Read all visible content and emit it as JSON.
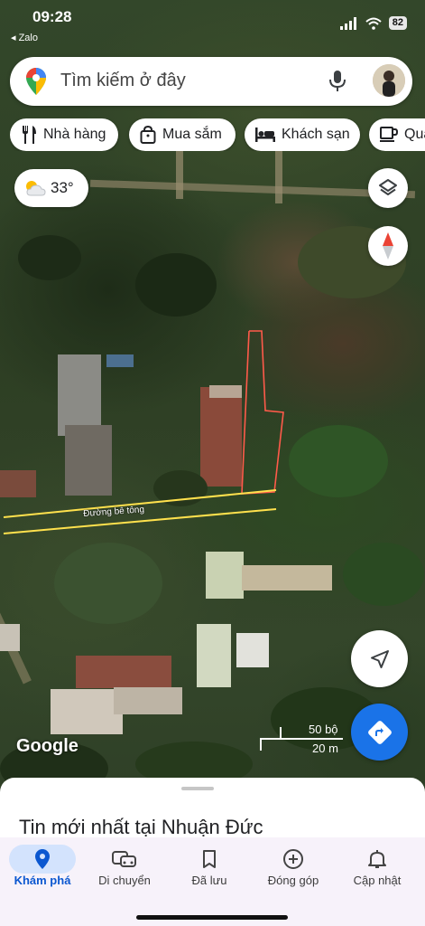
{
  "status_bar": {
    "time": "09:28",
    "back_app": "◂ Zalo",
    "battery": "82"
  },
  "search": {
    "placeholder": "Tìm kiếm ở đây"
  },
  "chips": [
    {
      "label": "Nhà hàng",
      "icon": "fork-knife-icon"
    },
    {
      "label": "Mua sắm",
      "icon": "shopping-bag-icon"
    },
    {
      "label": "Khách sạn",
      "icon": "bed-icon"
    },
    {
      "label": "Quá",
      "icon": "coffee-icon"
    }
  ],
  "weather": {
    "temperature": "33°",
    "icon": "partly-cloudy-icon"
  },
  "map": {
    "road_label": "Đường bê tông",
    "attribution": "Google",
    "scale_imperial": "50 bộ",
    "scale_metric": "20 m",
    "parcel_outline_color": "#ff5a4a",
    "road_line_color": "#ffe14d"
  },
  "sheet": {
    "title": "Tin mới nhất tại Nhuận Đức"
  },
  "bottom_nav": [
    {
      "label": "Khám phá",
      "icon": "location-pin-icon",
      "active": true
    },
    {
      "label": "Di chuyển",
      "icon": "car-icon",
      "active": false
    },
    {
      "label": "Đã lưu",
      "icon": "bookmark-icon",
      "active": false
    },
    {
      "label": "Đóng góp",
      "icon": "add-circle-icon",
      "active": false
    },
    {
      "label": "Cập nhật",
      "icon": "bell-icon",
      "active": false
    }
  ],
  "colors": {
    "accent_blue": "#1a73e8",
    "nav_active_bg": "#d3e3fd"
  }
}
